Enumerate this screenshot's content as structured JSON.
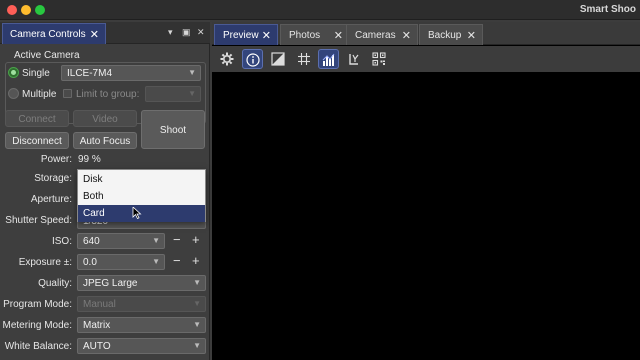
{
  "app": {
    "title": "Smart Shoo"
  },
  "dock": {
    "tab_label": "Camera Controls",
    "tab_close": "✕",
    "controls": {
      "menu": "▾",
      "float": "▣",
      "close": "✕"
    }
  },
  "active_camera": {
    "label": "Active Camera",
    "single_label": "Single",
    "single_value": "ILCE-7M4",
    "multiple_label": "Multiple",
    "limit_label": "Limit to group:",
    "limit_value": ""
  },
  "buttons": {
    "connect": "Connect",
    "video": "Video",
    "disconnect": "Disconnect",
    "auto_focus": "Auto Focus",
    "shoot": "Shoot"
  },
  "settings": {
    "power_label": "Power:",
    "power_value": "99 %",
    "storage_label": "Storage:",
    "aperture_label": "Aperture:",
    "shutter_label": "Shutter Speed:",
    "shutter_value_partial": "1/320",
    "iso_label": "ISO:",
    "iso_value": "640",
    "exposure_label": "Exposure ±:",
    "exposure_value": "0.0",
    "quality_label": "Quality:",
    "quality_value": "JPEG Large",
    "program_label": "Program Mode:",
    "program_value": "Manual",
    "metering_label": "Metering Mode:",
    "metering_value": "Matrix",
    "wb_label": "White Balance:",
    "wb_value": "AUTO",
    "minus": "−",
    "plus": "+"
  },
  "storage_dropdown": {
    "options": [
      "Disk",
      "Both",
      "Card"
    ],
    "highlighted": "Card"
  },
  "tabs": [
    {
      "label": "Preview",
      "active": true
    },
    {
      "label": "Photos",
      "active": false
    },
    {
      "label": "Cameras",
      "active": false
    },
    {
      "label": "Backup",
      "active": false
    }
  ],
  "tab_close": "✕",
  "toolbar_icons": [
    "gear-icon",
    "info-icon",
    "exposure-icon",
    "grid-icon",
    "histogram-icon",
    "focus-peaking-icon",
    "qr-code-icon"
  ],
  "colors": {
    "accent": "#2d3b6e",
    "active_radio": "#4aa24a",
    "viewport": "#000000"
  }
}
